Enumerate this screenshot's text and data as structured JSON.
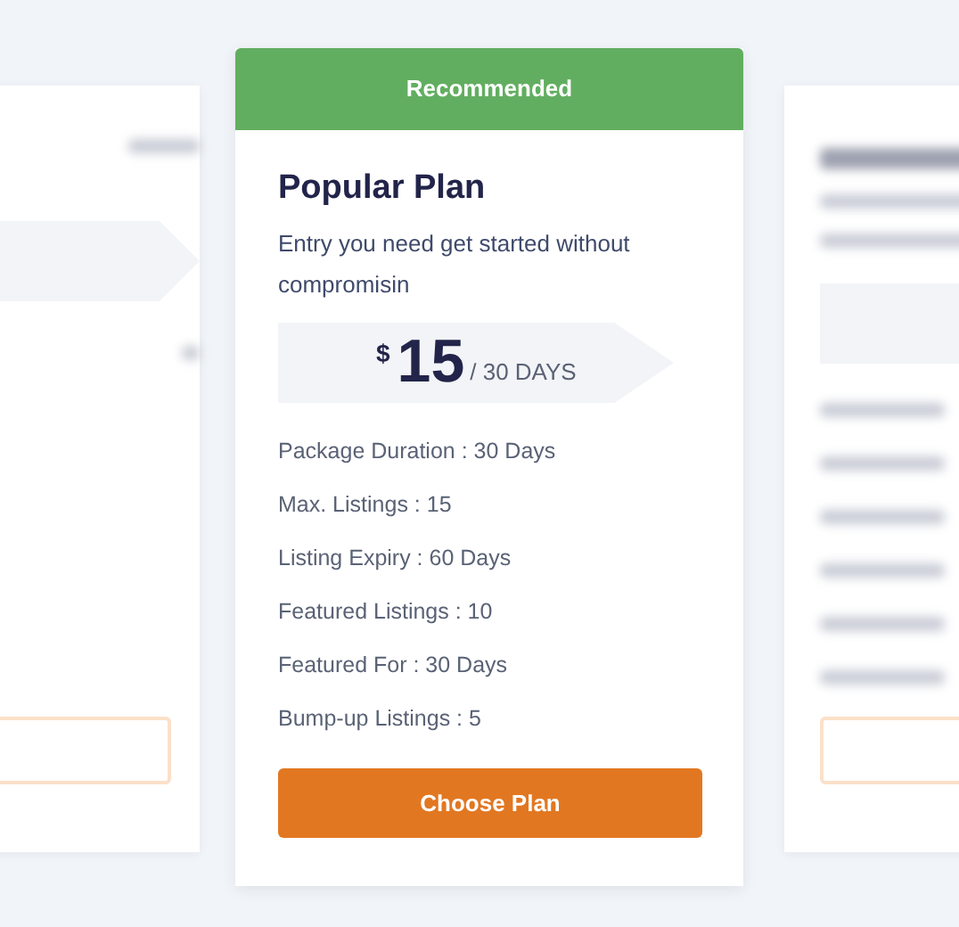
{
  "plan": {
    "badge": "Recommended",
    "title": "Popular Plan",
    "description": "Entry you need get started without compromisin",
    "price": {
      "currency": "$",
      "amount": "15",
      "period": "/ 30 DAYS"
    },
    "features": [
      "Package Duration : 30 Days",
      "Max. Listings : 15",
      "Listing Expiry : 60 Days",
      "Featured Listings : 10",
      "Featured For : 30 Days",
      "Bump-up Listings : 5"
    ],
    "button": "Choose Plan"
  }
}
